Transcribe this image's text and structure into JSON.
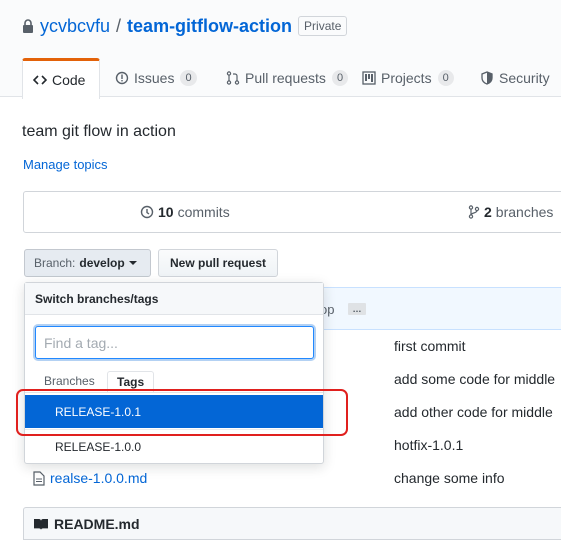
{
  "repo": {
    "owner": "ycvbcvfu",
    "separator": "/",
    "name": "team-gitflow-action",
    "visibility": "Private"
  },
  "tabs": [
    {
      "label": "Code",
      "icon": "code-icon",
      "selected": true
    },
    {
      "label": "Issues",
      "count": "0",
      "icon": "issue-icon"
    },
    {
      "label": "Pull requests",
      "count": "0",
      "icon": "pull-request-icon"
    },
    {
      "label": "Projects",
      "count": "0",
      "icon": "project-icon"
    },
    {
      "label": "Security",
      "icon": "shield-icon"
    }
  ],
  "description": "team git flow in action",
  "manage_topics": "Manage topics",
  "stats": {
    "commits_count": "10",
    "commits_label": "commits",
    "branches_count": "2",
    "branches_label": "branches"
  },
  "branch_button": {
    "label": "Branch:",
    "value": "develop"
  },
  "new_pr_button": "New pull request",
  "latest_commit_partial": "op",
  "ellipsis": "…",
  "dropdown": {
    "header": "Switch branches/tags",
    "filter_placeholder": "Find a tag...",
    "tab_branches": "Branches",
    "tab_tags": "Tags",
    "items": [
      {
        "label": "RELEASE-1.0.1",
        "selected": true
      },
      {
        "label": "RELEASE-1.0.0",
        "selected": false
      }
    ]
  },
  "files": [
    {
      "name": "",
      "commit": "first commit"
    },
    {
      "name": "",
      "commit": "add some code for middle"
    },
    {
      "name": "",
      "commit": "add other code for middle"
    },
    {
      "name": "",
      "commit": "hotfix-1.0.1"
    },
    {
      "name": "realse-1.0.0.md",
      "commit": "change some info"
    }
  ],
  "readme_title": "README.md",
  "colors": {
    "link": "#0366d6",
    "selected_tab_accent": "#e36209",
    "dropdown_selected_bg": "#0366d6",
    "highlight_annotation": "#e0201e"
  }
}
